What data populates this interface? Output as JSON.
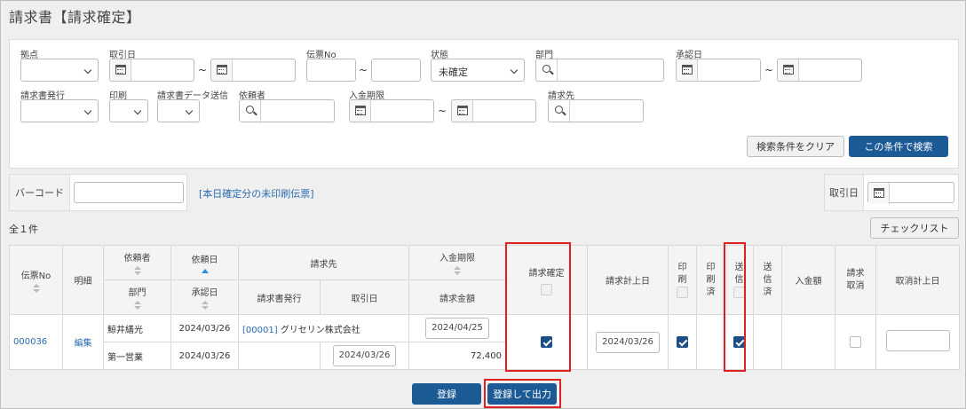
{
  "page": {
    "title": "請求書【請求確定】"
  },
  "search": {
    "row1": {
      "base_label": "拠点",
      "trade_date_label": "取引日",
      "slip_no_label": "伝票No",
      "status_label": "状態",
      "status_value": "未確定",
      "department_label": "部門",
      "approval_date_label": "承認日"
    },
    "row2": {
      "invoice_issue_label": "請求書発行",
      "print_label": "印刷",
      "data_send_label": "請求書データ送信",
      "requester_label": "依頼者",
      "payment_due_label": "入金期限",
      "billing_to_label": "請求先"
    },
    "tilde": "~",
    "clear_button": "検索条件をクリア",
    "search_button": "この条件で検索"
  },
  "barcode": {
    "label": "バーコード"
  },
  "today_unprinted_link": "[本日確定分の未印刷伝票]",
  "trade_date_filter": {
    "label": "取引日"
  },
  "total_count": "全１件",
  "checklist_button": "チェックリスト",
  "table": {
    "headers": {
      "slip_no": "伝票No",
      "detail": "明細",
      "requester": "依頼者",
      "department": "部門",
      "request_date": "依頼日",
      "approval_date": "承認日",
      "billing_to": "請求先",
      "invoice_issue": "請求書発行",
      "trade_date": "取引日",
      "payment_due": "入金期限",
      "billing_amount": "請求金額",
      "billing_confirm": "請求確定",
      "billing_post_date": "請求計上日",
      "print": "印刷",
      "printed": "印刷済",
      "send": "送信",
      "sent": "送信済",
      "deposit_amount": "入金額",
      "billing_cancel": "請求取消",
      "cancel_post_date": "取消計上日"
    },
    "row": {
      "slip_no": "000036",
      "detail_link": "編集",
      "requester": "鯨井繕光",
      "department": "第一営業",
      "request_date": "2024/03/26",
      "approval_date": "2024/03/26",
      "billing_to_code": "[00001]",
      "billing_to_name": "グリセリン株式会社",
      "trade_date": "2024/03/26",
      "payment_due": "2024/04/25",
      "billing_amount": "72,400",
      "billing_confirm_checked": true,
      "billing_post_date": "2024/03/26",
      "print_checked": true,
      "send_checked": true,
      "billing_cancel_checked": false
    }
  },
  "footer": {
    "register_button": "登録",
    "register_output_button": "登録して出力"
  },
  "colors": {
    "primary": "#1c5a96",
    "link": "#2a6db0",
    "highlight": "#e02020"
  }
}
